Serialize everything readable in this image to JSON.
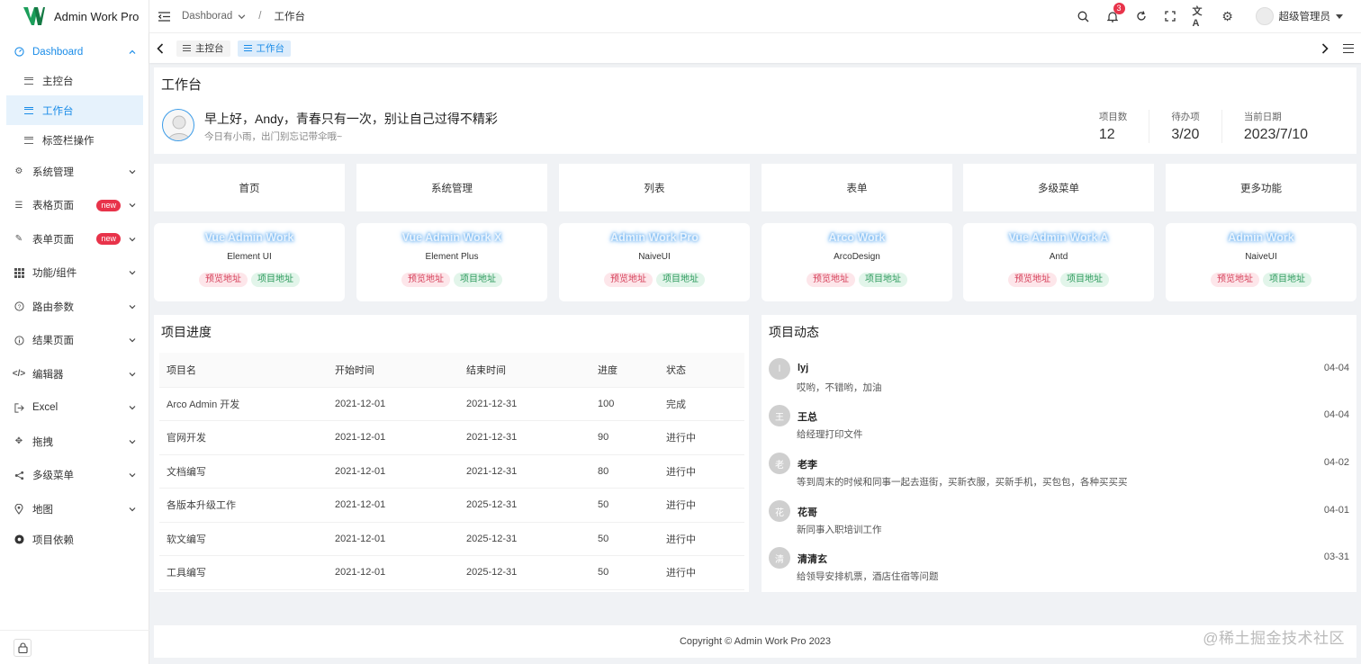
{
  "app": {
    "title": "Admin Work Pro"
  },
  "sidebar": {
    "dashboard": "Dashboard",
    "sub_items": [
      {
        "label": "主控台"
      },
      {
        "label": "工作台"
      },
      {
        "label": "标签栏操作"
      }
    ],
    "items": [
      {
        "label": "系统管理",
        "icon": "gear-icon"
      },
      {
        "label": "表格页面",
        "badge": "new",
        "icon": "table-icon"
      },
      {
        "label": "表单页面",
        "badge": "new",
        "icon": "form-icon"
      },
      {
        "label": "功能/组件",
        "icon": "grid-icon"
      },
      {
        "label": "路由参数",
        "icon": "question-icon"
      },
      {
        "label": "结果页面",
        "icon": "info-icon"
      },
      {
        "label": "编辑器",
        "icon": "code-icon"
      },
      {
        "label": "Excel",
        "icon": "export-icon"
      },
      {
        "label": "拖拽",
        "icon": "drag-icon"
      },
      {
        "label": "多级菜单",
        "icon": "share-icon"
      },
      {
        "label": "地图",
        "icon": "location-icon"
      }
    ],
    "project_deps": "项目依赖"
  },
  "header": {
    "breadcrumb_root": "Dashborad",
    "breadcrumb_sep": "/",
    "breadcrumb_current": "工作台",
    "notify_count": "3",
    "user_name": "超级管理员"
  },
  "tabs": [
    {
      "label": "主控台"
    },
    {
      "label": "工作台"
    }
  ],
  "welcome": {
    "title": "工作台",
    "greeting": "早上好，Andy，青春只有一次，别让自己过得不精彩",
    "sub": "今日有小雨，出门别忘记带伞哦~",
    "stats": [
      {
        "label": "项目数",
        "value": "12"
      },
      {
        "label": "待办项",
        "value": "3/20"
      },
      {
        "label": "当前日期",
        "value": "2023/7/10"
      }
    ]
  },
  "quick_links": [
    {
      "label": "首页"
    },
    {
      "label": "系统管理"
    },
    {
      "label": "列表"
    },
    {
      "label": "表单"
    },
    {
      "label": "多级菜单"
    },
    {
      "label": "更多功能"
    }
  ],
  "projects": [
    {
      "title": "Vue Admin Work",
      "ui": "Element UI"
    },
    {
      "title": "Vue Admin Work X",
      "ui": "Element Plus"
    },
    {
      "title": "Admin Work Pro",
      "ui": "NaiveUI"
    },
    {
      "title": "Arco Work",
      "ui": "ArcoDesign"
    },
    {
      "title": "Vue Admin Work A",
      "ui": "Antd"
    },
    {
      "title": "Admin Work",
      "ui": "NaiveUI"
    }
  ],
  "project_buttons": {
    "preview": "预览地址",
    "repo": "项目地址"
  },
  "progress": {
    "title": "项目进度",
    "columns": [
      "项目名",
      "开始时间",
      "结束时间",
      "进度",
      "状态"
    ],
    "rows": [
      [
        "Arco Admin 开发",
        "2021-12-01",
        "2021-12-31",
        "100",
        "完成"
      ],
      [
        "官网开发",
        "2021-12-01",
        "2021-12-31",
        "90",
        "进行中"
      ],
      [
        "文档编写",
        "2021-12-01",
        "2021-12-31",
        "80",
        "进行中"
      ],
      [
        "各版本升级工作",
        "2021-12-01",
        "2025-12-31",
        "50",
        "进行中"
      ],
      [
        "软文编写",
        "2021-12-01",
        "2025-12-31",
        "50",
        "进行中"
      ],
      [
        "工具编写",
        "2021-12-01",
        "2025-12-31",
        "50",
        "进行中"
      ]
    ]
  },
  "feed": {
    "title": "项目动态",
    "items": [
      {
        "avatar": "l",
        "name": "lyj",
        "date": "04-04",
        "text": "哎哟，不错哟，加油"
      },
      {
        "avatar": "王",
        "name": "王总",
        "date": "04-04",
        "text": "给经理打印文件"
      },
      {
        "avatar": "老",
        "name": "老李",
        "date": "04-02",
        "text": "等到周末的时候和同事一起去逛街，买新衣服，买新手机，买包包，各种买买买"
      },
      {
        "avatar": "花",
        "name": "花哥",
        "date": "04-01",
        "text": "新同事入职培训工作"
      },
      {
        "avatar": "清",
        "name": "清清玄",
        "date": "03-31",
        "text": "给领导安排机票，酒店住宿等问题"
      }
    ]
  },
  "footer": "Copyright © Admin Work Pro 2023",
  "watermark": "@稀土掘金技术社区",
  "colors": {
    "accent": "#1a8ce8",
    "danger": "#e8334a",
    "success": "#2c9a5c"
  }
}
